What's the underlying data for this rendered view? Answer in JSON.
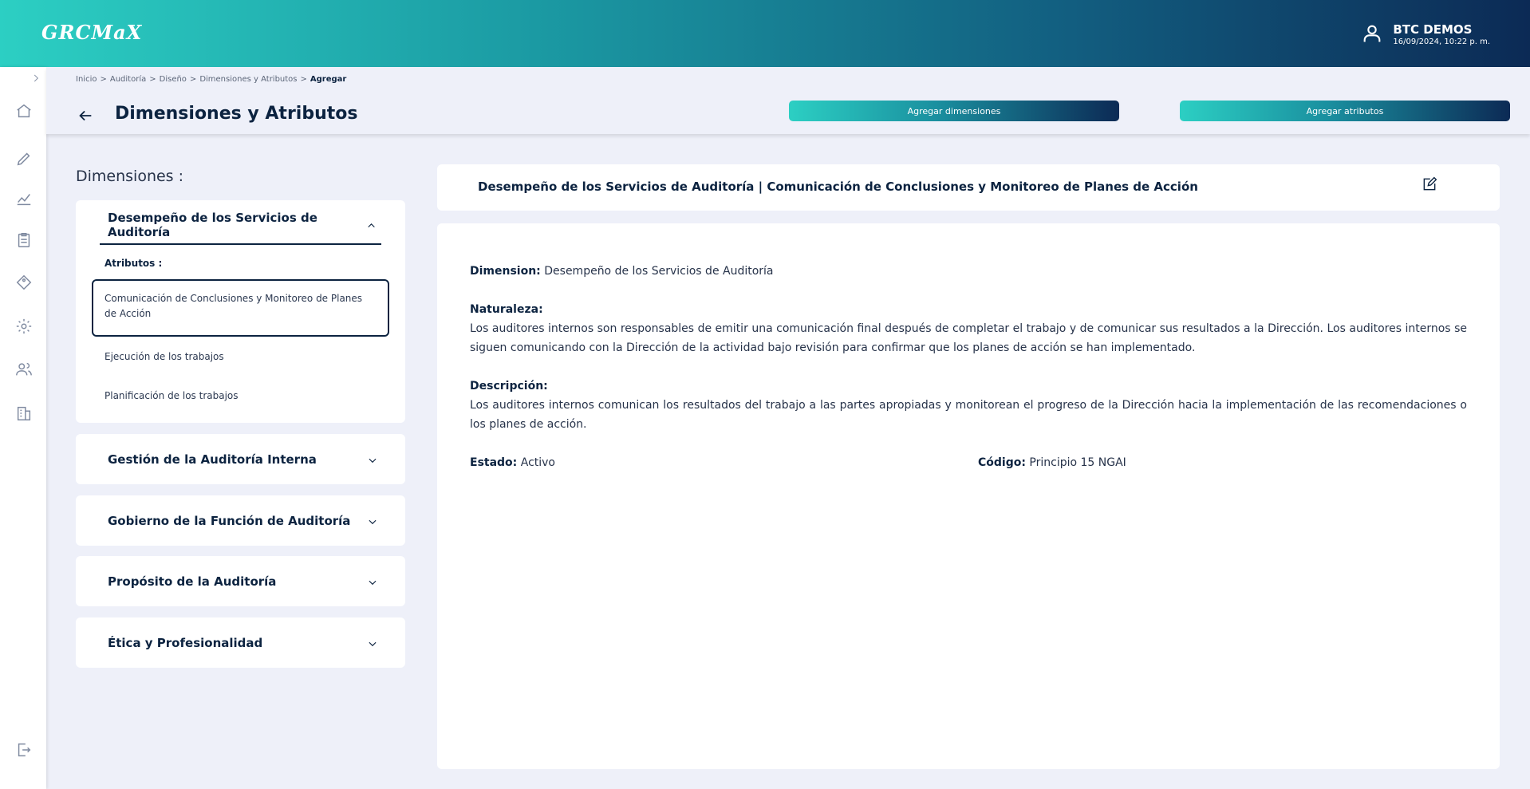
{
  "header": {
    "logo": "GRCMaX",
    "user_name": "BTC DEMOS",
    "user_date": "16/09/2024, 10:22 p. m."
  },
  "breadcrumb": [
    "Inicio",
    "Auditoría",
    "Diseño",
    "Dimensiones y Atributos",
    "Agregar"
  ],
  "page": {
    "title": "Dimensiones y Atributos",
    "btn_add_dimensions": "Agregar dimensiones",
    "btn_add_attributes": "Agregar atributos"
  },
  "left": {
    "dimensions_label": "Dimensiones :",
    "attributes_label": "Atributos :",
    "expanded_dimension": "Desempeño de los Servicios de Auditoría",
    "attributes": [
      "Comunicación de Conclusiones y Monitoreo de Planes de Acción",
      "Ejecución de los trabajos",
      "Planificación de los trabajos"
    ],
    "collapsed_dimensions": [
      "Gestión de la Auditoría Interna",
      "Gobierno de la Función de Auditoría",
      "Propósito de la Auditoría",
      "Ética y Profesionalidad"
    ]
  },
  "detail": {
    "title": "Desempeño de los Servicios de Auditoría | Comunicación de Conclusiones y Monitoreo de Planes de Acción",
    "dimension_label": "Dimension:",
    "dimension_value": "Desempeño de los Servicios de Auditoría",
    "naturaleza_label": "Naturaleza:",
    "naturaleza_value": "Los auditores internos son responsables de emitir una comunicación final después de completar el trabajo y de comunicar sus resultados a la Dirección. Los auditores internos se siguen comunicando con la Dirección de la actividad bajo revisión para confirmar que los planes de acción se han implementado.",
    "descripcion_label": "Descripción:",
    "descripcion_value": "Los auditores internos comunican los resultados del trabajo a las partes apropiadas y monitorean el progreso de la Dirección hacia la implementación de las recomendaciones o los planes de acción.",
    "estado_label": "Estado:",
    "estado_value": "Activo",
    "codigo_label": "Código:",
    "codigo_value": "Principio 15 NGAI"
  },
  "icons": {
    "sidebar": [
      "chevron-right-icon",
      "home-icon",
      "pencil-icon",
      "chart-icon",
      "clipboard-icon",
      "tag-icon",
      "gear-icon",
      "users-icon",
      "building-icon",
      "logout-icon"
    ],
    "header": "user-icon",
    "edit": "edit-icon"
  },
  "colors": {
    "gradient_start": "#2ccfc3",
    "gradient_end": "#0c2a55",
    "primary_text": "#0c2340",
    "page_background": "#eef0f9"
  }
}
